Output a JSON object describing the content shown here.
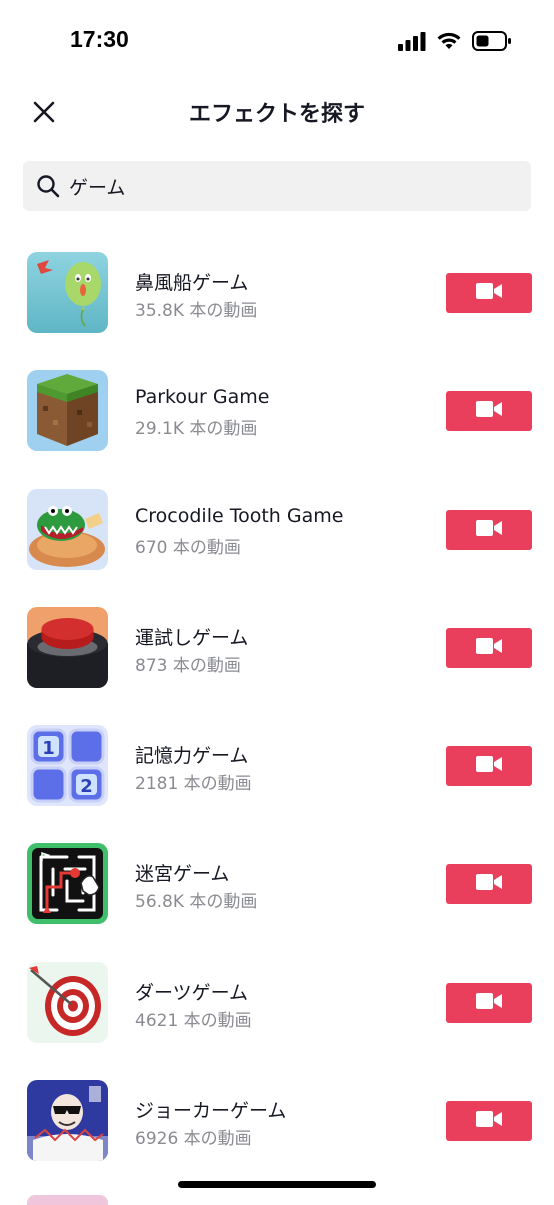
{
  "status_bar": {
    "time": "17:30"
  },
  "header": {
    "title": "エフェクトを探す"
  },
  "search": {
    "value": "ゲーム",
    "placeholder": ""
  },
  "effects": [
    {
      "name": "鼻風船ゲーム",
      "count": "35.8K 本の動画",
      "icon": "balloon-face-icon"
    },
    {
      "name": "Parkour Game",
      "count": "29.1K 本の動画",
      "icon": "grass-block-icon"
    },
    {
      "name": "Crocodile Tooth Game",
      "count": "670 本の動画",
      "icon": "crocodile-icon"
    },
    {
      "name": "運試しゲーム",
      "count": "873 本の動画",
      "icon": "red-button-icon"
    },
    {
      "name": "記憶力ゲーム",
      "count": "2181 本の動画",
      "icon": "number-tiles-icon"
    },
    {
      "name": "迷宮ゲーム",
      "count": "56.8K 本の動画",
      "icon": "maze-icon"
    },
    {
      "name": "ダーツゲーム",
      "count": "4621 本の動画",
      "icon": "dartboard-icon"
    },
    {
      "name": "ジョーカーゲーム",
      "count": "6926 本の動画",
      "icon": "joker-cards-icon"
    }
  ],
  "colors": {
    "accent": "#ea3f5c",
    "muted_text": "#8a8b91",
    "search_bg": "#f1f1f2"
  }
}
